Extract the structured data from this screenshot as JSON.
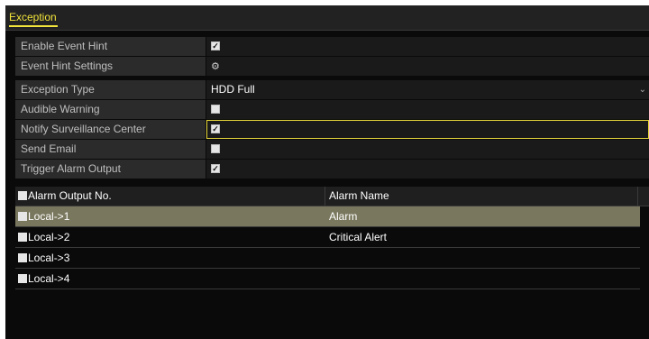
{
  "tab": {
    "label": "Exception"
  },
  "settings": {
    "enable_event_hint": {
      "label": "Enable Event Hint",
      "checked": true
    },
    "event_hint_settings": {
      "label": "Event Hint Settings",
      "icon": "gear-icon"
    },
    "exception_type": {
      "label": "Exception Type",
      "value": "HDD Full"
    },
    "audible_warning": {
      "label": "Audible Warning",
      "checked": false
    },
    "notify_surveillance_center": {
      "label": "Notify Surveillance Center",
      "checked": true
    },
    "send_email": {
      "label": "Send Email",
      "checked": false
    },
    "trigger_alarm_output": {
      "label": "Trigger Alarm Output",
      "checked": true
    }
  },
  "alarm_table": {
    "headers": [
      "Alarm Output No.",
      "Alarm Name"
    ],
    "rows": [
      {
        "no": "Local->1",
        "name": "Alarm",
        "checked": false,
        "selected": true
      },
      {
        "no": "Local->2",
        "name": "Critical Alert",
        "checked": false,
        "selected": false
      },
      {
        "no": "Local->3",
        "name": "",
        "checked": false,
        "selected": false
      },
      {
        "no": "Local->4",
        "name": "",
        "checked": false,
        "selected": false
      }
    ]
  },
  "colors": {
    "accent": "#f2e43a",
    "selected_row": "#79775e",
    "background": "#0a0a0a"
  }
}
